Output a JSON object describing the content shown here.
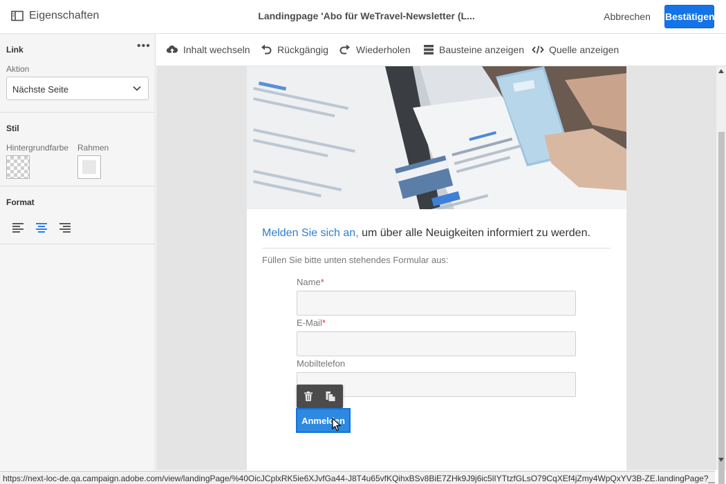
{
  "header": {
    "properties_label": "Eigenschaften",
    "title": "Landingpage 'Abo für WeTravel-Newsletter (L...",
    "cancel_label": "Abbrechen",
    "confirm_label": "Bestätigen"
  },
  "left_panel": {
    "link_title": "Link",
    "more_label": "•••",
    "action_label": "Aktion",
    "action_value": "Nächste Seite",
    "style_title": "Stil",
    "bg_color_label": "Hintergrundfarbe",
    "border_label": "Rahmen",
    "format_title": "Format"
  },
  "toolbar": {
    "switch_content": "Inhalt wechseln",
    "undo": "Rückgängig",
    "redo": "Wiederholen",
    "show_blocks": "Bausteine anzeigen",
    "show_source": "Quelle anzeigen"
  },
  "content": {
    "headline_accent": "Melden Sie sich an,",
    "headline_rest": " um über alle Neuigkeiten informiert zu werden.",
    "intro": "Füllen Sie bitte unten stehendes Formular aus:",
    "fields": [
      {
        "label": "Name",
        "required": "*"
      },
      {
        "label": "E-Mail",
        "required": "*"
      },
      {
        "label": "Mobiltelefon",
        "required": ""
      }
    ],
    "submit_label": "Anmelden"
  },
  "colors": {
    "accent": "#1473e6",
    "link_blue": "#2d7dd2",
    "submit_blue": "#2d8ae0",
    "required_red": "#d7373f"
  },
  "status_url": "https://next-loc-de.qa.campaign.adobe.com/view/landingPage/%40OicJCplxRK5ie6XJvfGa44-J8T4u65vfKQihxBSv8BiE7ZHk9J9j6ic5lIYTtzfGLsO79CqXEf4jZmy4WpQxYV3B-ZE.landingPage?__secu..."
}
